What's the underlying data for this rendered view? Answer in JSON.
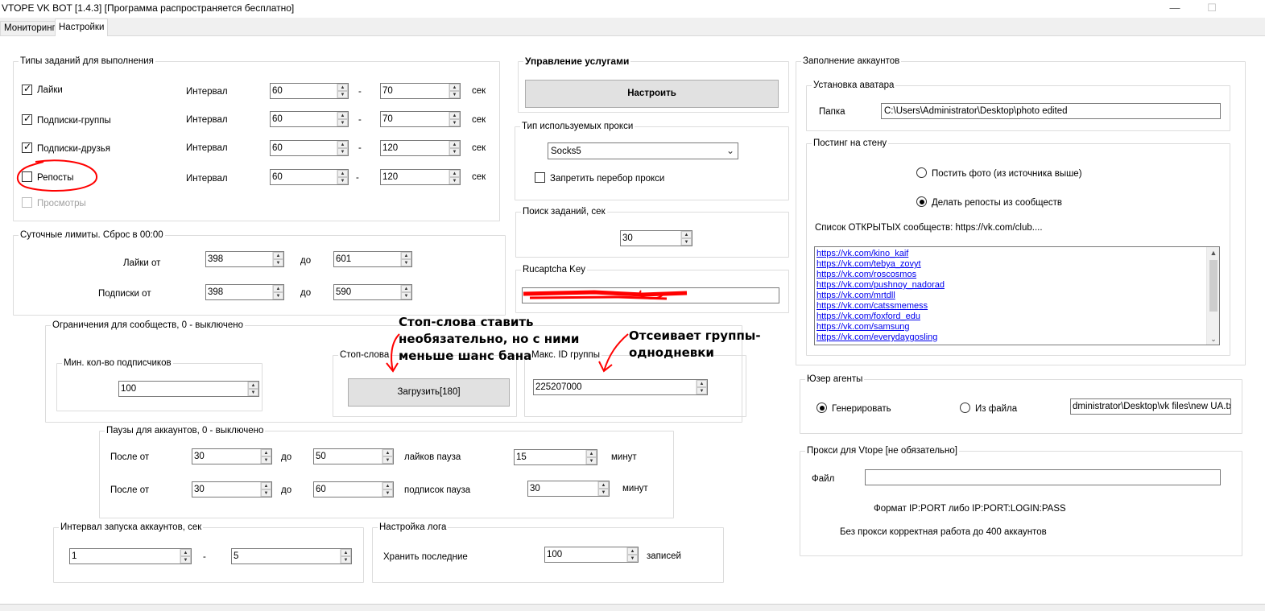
{
  "window": {
    "title": "VTOPE VK BOT [1.4.3]  [Программа распространяется бесплатно]",
    "minimize_glyph": "—",
    "maximize_glyph": "☐"
  },
  "tabs": [
    {
      "label": "Мониторинг",
      "active": false
    },
    {
      "label": "Настройки",
      "active": true
    }
  ],
  "task_types": {
    "title": "Типы заданий для выполнения",
    "interval_label": "Интервал",
    "dash": "-",
    "unit": "сек",
    "items": [
      {
        "label": "Лайки",
        "checked": true,
        "from": "60",
        "to": "70"
      },
      {
        "label": "Подписки-группы",
        "checked": true,
        "from": "60",
        "to": "70"
      },
      {
        "label": "Подписки-друзья",
        "checked": true,
        "from": "60",
        "to": "120"
      },
      {
        "label": "Репосты",
        "checked": false,
        "from": "60",
        "to": "120"
      },
      {
        "label": "Просмотры",
        "checked": false,
        "disabled": true
      }
    ]
  },
  "daily_limits": {
    "title": "Суточные лимиты. Сброс в 00:00",
    "to_label": "до",
    "likes": {
      "label": "Лайки от",
      "from": "398",
      "to": "601"
    },
    "subs": {
      "label": "Подписки от",
      "from": "398",
      "to": "590"
    }
  },
  "community_limits": {
    "title": "Ограничения для сообществ, 0 - выключено",
    "min_subs": {
      "title": "Мин. кол-во подписчиков",
      "value": "100"
    },
    "stop_words": {
      "title": "Стоп-слова",
      "button": "Загрузить[180]"
    },
    "max_id": {
      "title": "Макс. ID группы",
      "value": "225207000"
    }
  },
  "account_pauses": {
    "title": "Паузы для аккаунтов, 0 - выключено",
    "after_label": "После от",
    "to_label": "до",
    "minutes": "минут",
    "likes": {
      "from": "30",
      "to": "50",
      "pause_label": "лайков пауза",
      "pause": "15"
    },
    "subs": {
      "from": "30",
      "to": "60",
      "pause_label": "подписок пауза",
      "pause": "30"
    }
  },
  "launch_interval": {
    "title": "Интервал запуска аккаунтов, сек",
    "from": "1",
    "dash": "-",
    "to": "5"
  },
  "log_settings": {
    "title": "Настройка лога",
    "keep_label": "Хранить последние",
    "value": "100",
    "unit": "записей"
  },
  "services": {
    "title": "Управление услугами",
    "button": "Настроить"
  },
  "proxy_type": {
    "title": "Тип используемых прокси",
    "selected": "Socks5",
    "forbid_label": "Запретить перебор прокси",
    "forbid_checked": false
  },
  "task_search": {
    "title": "Поиск заданий, сек",
    "value": "30"
  },
  "rucaptcha": {
    "title": "Rucaptcha Key"
  },
  "accounts_fill": {
    "title": "Заполнение аккаунтов",
    "avatar": {
      "title": "Установка аватара",
      "folder_label": "Папка",
      "folder_value": "C:\\Users\\Administrator\\Desktop\\photo edited"
    },
    "wall": {
      "title": "Постинг на стену",
      "option_photo": "Постить фото (из источника выше)",
      "option_repost": "Делать репосты из сообществ",
      "selected": "repost",
      "list_label": "Список ОТКРЫТЫХ сообществ: https://vk.com/club....",
      "links": [
        "https://vk.com/kino_kaif",
        "https://vk.com/tebya_zovyt",
        "https://vk.com/roscosmos",
        "https://vk.com/pushnoy_nadorad",
        "https://vk.com/mrtdll",
        "https://vk.com/catssmemess",
        "https://vk.com/foxford_edu",
        "https://vk.com/samsung",
        "https://vk.com/everydaygosling"
      ]
    }
  },
  "user_agents": {
    "title": "Юзер агенты",
    "generate": "Генерировать",
    "from_file": "Из файла",
    "selected": "generate",
    "file_path": "dministrator\\Desktop\\vk files\\new UA.txt"
  },
  "vtope_proxy": {
    "title": "Прокси для Vtope [не обязательно]",
    "file_label": "Файл",
    "format": "Формат IP:PORT либо IP:PORT:LOGIN:PASS",
    "note": "Без прокси корректная работа до 400 аккаунтов"
  },
  "annotations": {
    "stop_words": [
      "Стоп-слова ставить",
      "необязательно, но с ними",
      "меньше шанс бана"
    ],
    "groups": [
      "Отсеивает группы-",
      "однодневки"
    ],
    "color": "#ff0000"
  },
  "icons": {
    "check": "✓",
    "spin_up": "▲",
    "spin_down": "▼",
    "dropdown": "⌄",
    "scroll_up": "▲",
    "scroll_down": "⌄"
  }
}
